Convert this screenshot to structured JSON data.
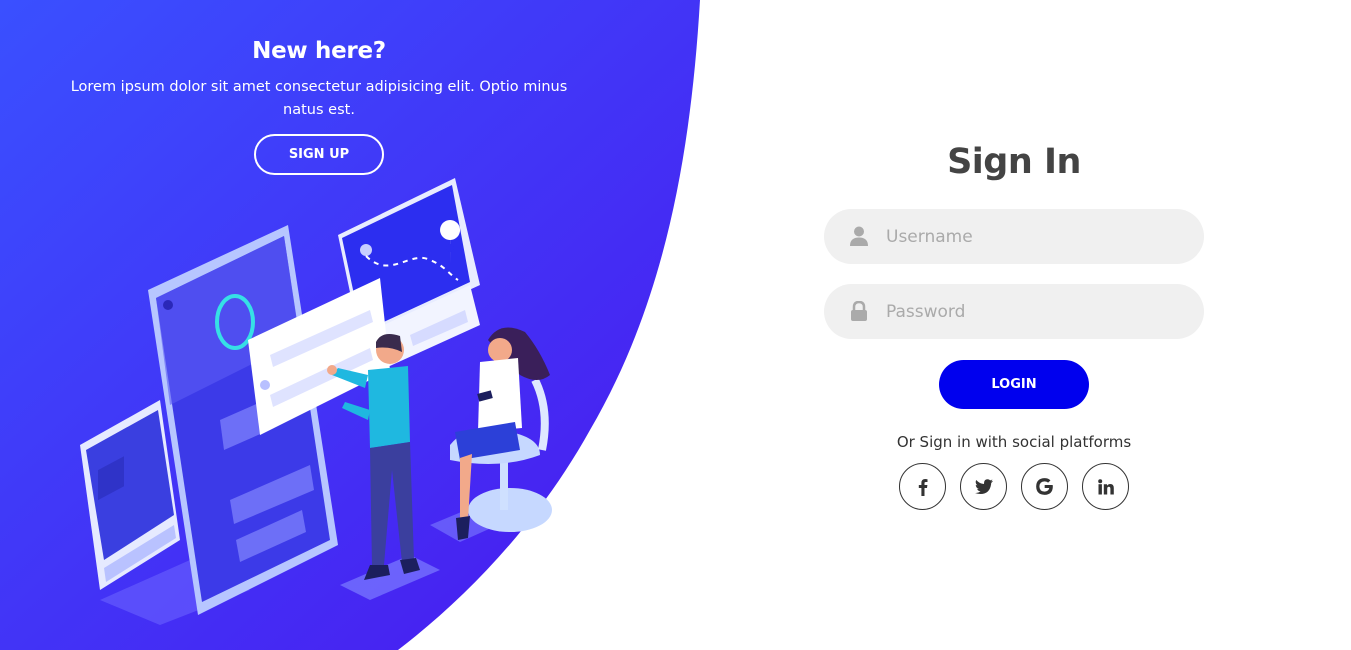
{
  "left_panel": {
    "title": "New here?",
    "text": "Lorem ipsum dolor sit amet consectetur adipisicing elit. Optio minus natus est.",
    "signup_label": "SIGN UP",
    "colors": {
      "gradient_start": "#3a4bff",
      "gradient_end": "#4a1df0"
    }
  },
  "signin": {
    "title": "Sign In",
    "username": {
      "placeholder": "Username",
      "value": "",
      "icon": "user-icon"
    },
    "password": {
      "placeholder": "Password",
      "value": "",
      "icon": "lock-icon"
    },
    "login_label": "LOGIN",
    "social_text": "Or Sign in with social platforms",
    "social": [
      {
        "name": "facebook",
        "icon": "facebook-icon"
      },
      {
        "name": "twitter",
        "icon": "twitter-icon"
      },
      {
        "name": "google",
        "icon": "google-icon"
      },
      {
        "name": "linkedin",
        "icon": "linkedin-icon"
      }
    ],
    "colors": {
      "button": "#0000ee",
      "field_bg": "#f0f0f0",
      "title": "#444444"
    }
  }
}
